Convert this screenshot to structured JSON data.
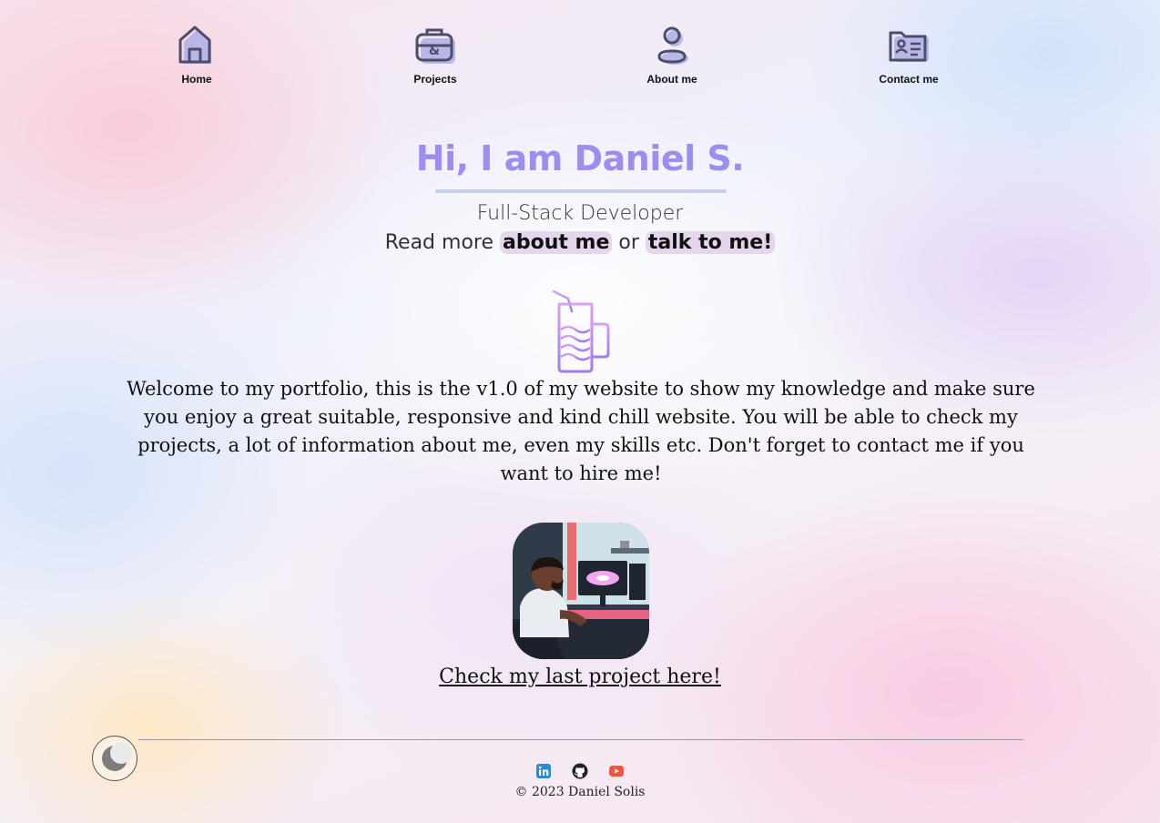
{
  "nav": {
    "items": [
      {
        "label": "Home",
        "icon": "home-icon"
      },
      {
        "label": "Projects",
        "icon": "briefcase-icon"
      },
      {
        "label": "About me",
        "icon": "user-icon"
      },
      {
        "label": "Contact me",
        "icon": "contact-card-icon"
      }
    ]
  },
  "hero": {
    "title": "Hi, I am Daniel S.",
    "subtitle": "Full-Stack Developer",
    "read_prefix": "Read more ",
    "about_link": "about me",
    "or_text": " or ",
    "talk_link": "talk to me!"
  },
  "intro": {
    "icon": "drink-glass-icon",
    "text": "Welcome to my portfolio, this is the v1.0 of my website to show my knowledge and make sure you enjoy a great suitable, responsive and kind chill website. You will be able to check my projects, a lot of information about me, even my skills etc. Don't forget to contact me if you want to hire me!"
  },
  "project": {
    "image": "developer-at-desk-illustration",
    "link_text": "Check my last project here!"
  },
  "footer": {
    "theme_toggle": "moon-icon",
    "socials": [
      "linkedin-icon",
      "github-icon",
      "youtube-icon"
    ],
    "copyright": "© 2023 Daniel Solis"
  },
  "colors": {
    "accent": "#9a8ff0",
    "icon_stroke": "#4a4e6a",
    "icon_shadow": "#b9b6e8",
    "pill": "#e5d6ee",
    "linkedin": "#2b8ad6",
    "youtube": "#f2543c"
  }
}
